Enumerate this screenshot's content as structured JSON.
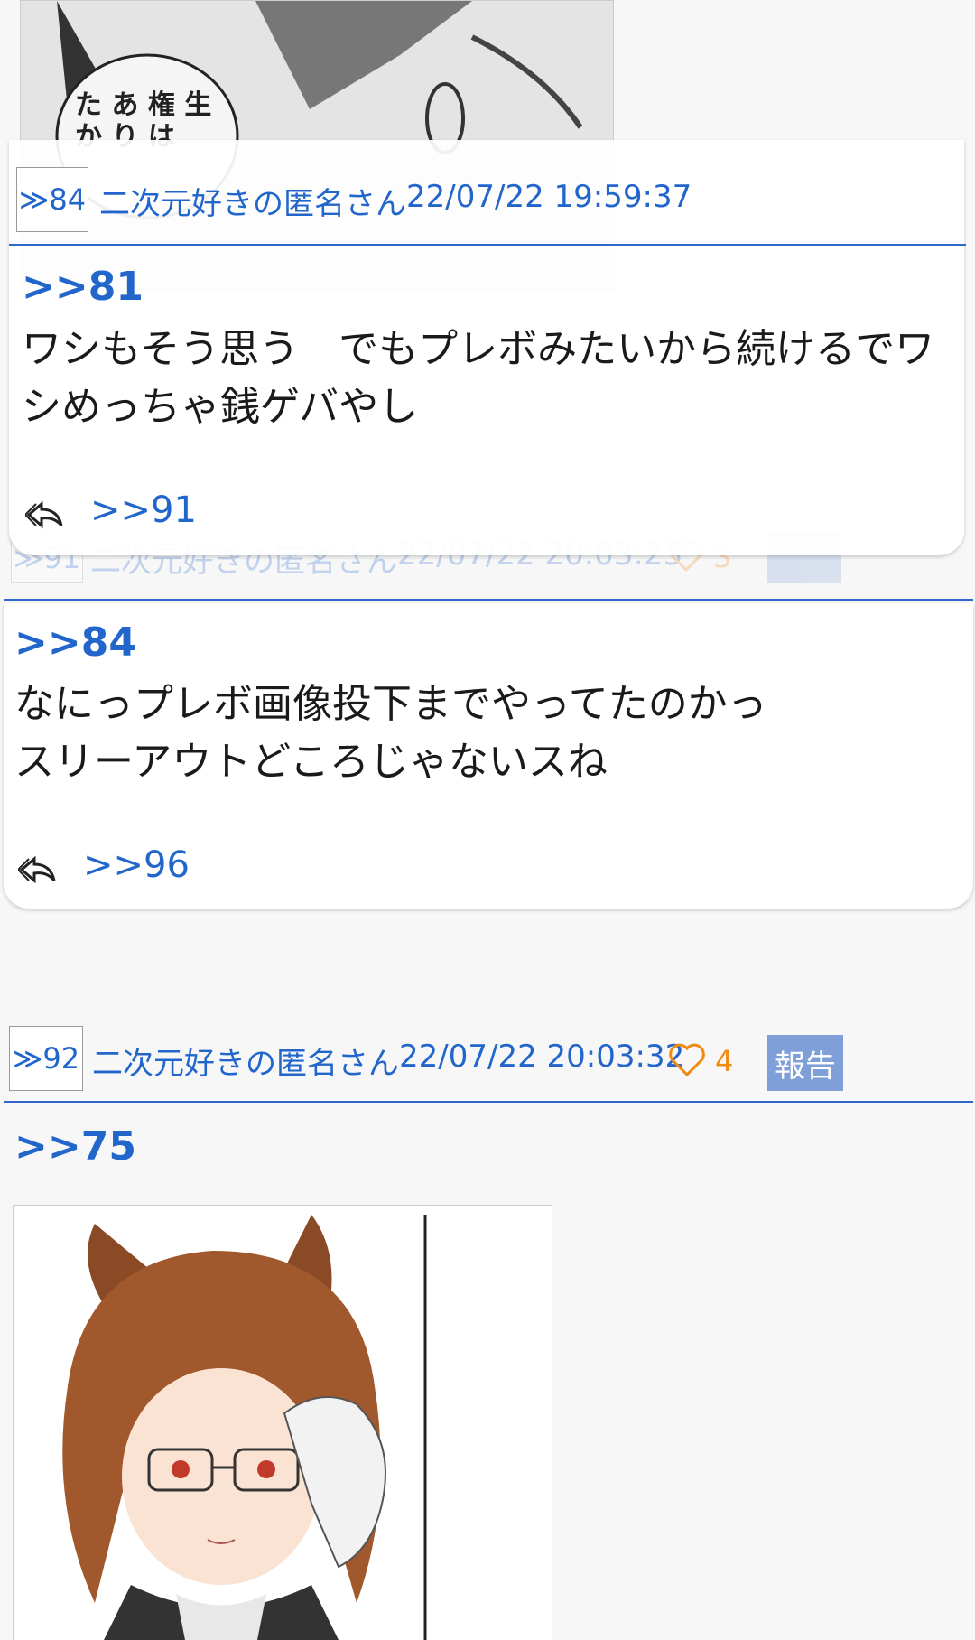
{
  "post_84": {
    "num": "≫84",
    "author": "二次元好きの匿名さん",
    "date": "22/07/22 19:59:37",
    "anchor": ">>81",
    "lines": [
      "ワシもそう思う　でもプレボみたいから続けるでワ",
      "シめっちゃ銭ゲバやし"
    ],
    "reply": ">>91"
  },
  "post_91_faded": {
    "num": "≫91",
    "author": "二次元好きの匿名さん",
    "date": "22/07/22 20:03:23",
    "likes": "3"
  },
  "post_91": {
    "anchor": ">>84",
    "lines": [
      "なにっプレボ画像投下までやってたのかっ",
      "スリーアウトどころじゃないスね"
    ],
    "reply": ">>96"
  },
  "post_92": {
    "num": "≫92",
    "author": "二次元好きの匿名さん",
    "date": "22/07/22 20:03:32",
    "likes": "4",
    "report": "報告",
    "anchor": ">>75"
  },
  "colors": {
    "link": "#2266cc",
    "like": "#f08a10",
    "report_bg": "#7f9fd9"
  }
}
